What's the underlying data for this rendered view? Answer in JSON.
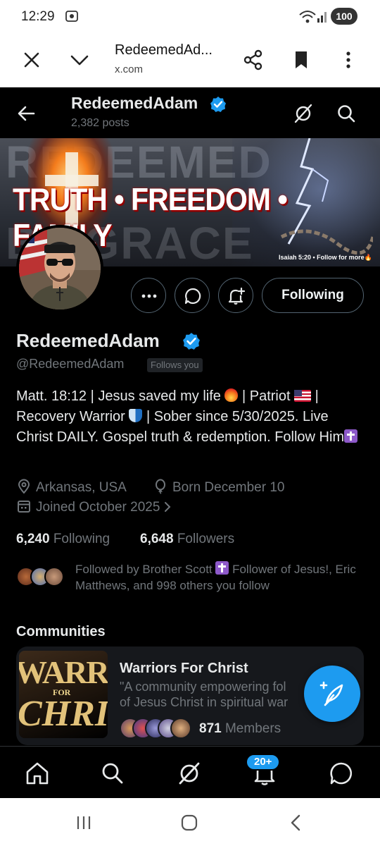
{
  "status_bar": {
    "time": "12:29",
    "battery": "100"
  },
  "browser": {
    "title": "RedeemedAd...",
    "url": "x.com"
  },
  "header": {
    "name": "RedeemedAdam",
    "posts": "2,382 posts"
  },
  "banner": {
    "tagline": "TRUTH • FREEDOM • FAMILY",
    "bg_text_top": "REDEEMED",
    "bg_text_bottom": "BY GRACE",
    "verse": "Isaiah 5:20 • Follow for more🔥"
  },
  "actions": {
    "following_label": "Following"
  },
  "profile": {
    "display_name": "RedeemedAdam",
    "handle": "@RedeemedAdam",
    "follows_you": "Follows you",
    "bio": {
      "part1": "Matt. 18:12 | Jesus saved my life ",
      "part2": " | Patriot ",
      "part3": " | Recovery Warrior ",
      "part4": " | Sober since 5/30/2025. Live Christ DAILY. Gospel truth & redemption. Follow Him"
    },
    "location": "Arkansas, USA",
    "born": "Born December 10",
    "joined": "Joined October 2025",
    "following_count": "6,240",
    "following_label": "Following",
    "followers_count": "6,648",
    "followers_label": "Followers",
    "followed_by": {
      "part1": "Followed by Brother Scott ",
      "part2": " Follower of Jesus!, Eric Matthews, and 998 others you follow"
    }
  },
  "communities": {
    "title": "Communities",
    "items": [
      {
        "name": "Warriors For Christ",
        "description_line1": "\"A community empowering fol",
        "description_line2": "of Jesus Christ in spiritual war",
        "members_count": "871",
        "members_label": "Members",
        "image_text": [
          "WARRIOR",
          "FOR",
          "CHRIST"
        ]
      }
    ]
  },
  "tab_bar": {
    "notifications_badge": "20+"
  },
  "colors": {
    "accent": "#1d9bf0",
    "background": "#000000",
    "text": "#e7e9ea",
    "muted": "#71767b"
  }
}
